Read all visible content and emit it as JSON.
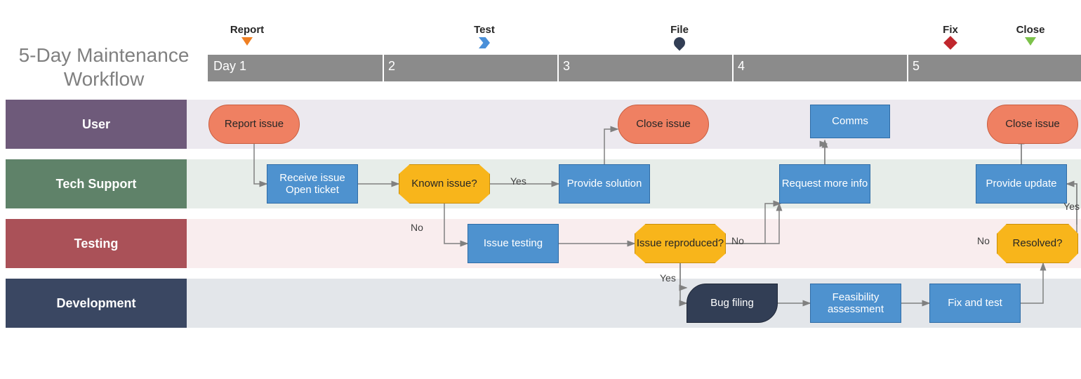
{
  "title": "5-Day Maintenance Workflow",
  "days": [
    "Day 1",
    "2",
    "3",
    "4",
    "5"
  ],
  "milestones": [
    {
      "label": "Report",
      "shape": "tri",
      "color": "#ef7f22"
    },
    {
      "label": "Test",
      "shape": "chevron",
      "color": "#4a90d9"
    },
    {
      "label": "File",
      "shape": "drop",
      "color": "#323e55"
    },
    {
      "label": "Fix",
      "shape": "diamond",
      "color": "#c0272d"
    },
    {
      "label": "Close",
      "shape": "tri",
      "color": "#7cc24a"
    }
  ],
  "lanes": [
    "User",
    "Tech Support",
    "Testing",
    "Development"
  ],
  "nodes": {
    "report_issue": "Report issue",
    "receive_open": "Receive issue\nOpen ticket",
    "known_issue": "Known issue?",
    "provide_solution": "Provide solution",
    "close_issue_a": "Close issue",
    "issue_testing": "Issue testing",
    "issue_repro": "Issue reproduced?",
    "request_more": "Request more info",
    "comms": "Comms",
    "bug_filing": "Bug filing",
    "feasibility": "Feasibility assessment",
    "fix_test": "Fix and test",
    "resolved": "Resolved?",
    "provide_update": "Provide update",
    "close_issue_b": "Close issue"
  },
  "edge_labels": {
    "yes": "Yes",
    "no": "No"
  },
  "chart_data": {
    "type": "swimlane-flowchart",
    "title": "5-Day Maintenance Workflow",
    "timeline": {
      "unit": "day",
      "start": 1,
      "end": 5,
      "milestones": [
        {
          "name": "Report",
          "day": 1
        },
        {
          "name": "Test",
          "day": 2
        },
        {
          "name": "File",
          "day": 3
        },
        {
          "name": "Fix",
          "day": 5
        },
        {
          "name": "Close",
          "day": 5
        }
      ]
    },
    "lanes": [
      "User",
      "Tech Support",
      "Testing",
      "Development"
    ],
    "nodes": [
      {
        "id": "report_issue",
        "lane": "User",
        "day": 1,
        "type": "terminator",
        "label": "Report issue"
      },
      {
        "id": "receive_open",
        "lane": "Tech Support",
        "day": 1,
        "type": "process",
        "label": "Receive issue / Open ticket"
      },
      {
        "id": "known_issue",
        "lane": "Tech Support",
        "day": 2,
        "type": "decision",
        "label": "Known issue?"
      },
      {
        "id": "provide_solution",
        "lane": "Tech Support",
        "day": 3,
        "type": "process",
        "label": "Provide solution"
      },
      {
        "id": "close_issue_a",
        "lane": "User",
        "day": 3,
        "type": "terminator",
        "label": "Close issue"
      },
      {
        "id": "issue_testing",
        "lane": "Testing",
        "day": 2,
        "type": "process",
        "label": "Issue testing"
      },
      {
        "id": "issue_repro",
        "lane": "Testing",
        "day": 3,
        "type": "decision",
        "label": "Issue reproduced?"
      },
      {
        "id": "request_more",
        "lane": "Tech Support",
        "day": 4,
        "type": "process",
        "label": "Request more info"
      },
      {
        "id": "comms",
        "lane": "User",
        "day": 4,
        "type": "process",
        "label": "Comms"
      },
      {
        "id": "bug_filing",
        "lane": "Development",
        "day": 3,
        "type": "document",
        "label": "Bug filing"
      },
      {
        "id": "feasibility",
        "lane": "Development",
        "day": 4,
        "type": "process",
        "label": "Feasibility assessment"
      },
      {
        "id": "fix_test",
        "lane": "Development",
        "day": 5,
        "type": "process",
        "label": "Fix and test"
      },
      {
        "id": "resolved",
        "lane": "Testing",
        "day": 5,
        "type": "decision",
        "label": "Resolved?"
      },
      {
        "id": "provide_update",
        "lane": "Tech Support",
        "day": 5,
        "type": "process",
        "label": "Provide update"
      },
      {
        "id": "close_issue_b",
        "lane": "User",
        "day": 5,
        "type": "terminator",
        "label": "Close issue"
      }
    ],
    "edges": [
      {
        "from": "report_issue",
        "to": "receive_open"
      },
      {
        "from": "receive_open",
        "to": "known_issue"
      },
      {
        "from": "known_issue",
        "to": "provide_solution",
        "label": "Yes"
      },
      {
        "from": "known_issue",
        "to": "issue_testing",
        "label": "No"
      },
      {
        "from": "provide_solution",
        "to": "close_issue_a"
      },
      {
        "from": "issue_testing",
        "to": "issue_repro"
      },
      {
        "from": "issue_repro",
        "to": "request_more",
        "label": "No"
      },
      {
        "from": "issue_repro",
        "to": "bug_filing",
        "label": "Yes"
      },
      {
        "from": "request_more",
        "to": "comms"
      },
      {
        "from": "bug_filing",
        "to": "feasibility"
      },
      {
        "from": "feasibility",
        "to": "fix_test"
      },
      {
        "from": "fix_test",
        "to": "resolved"
      },
      {
        "from": "resolved",
        "to": "provide_update",
        "label": "Yes"
      },
      {
        "from": "resolved",
        "to": "fix_test",
        "label": "No"
      },
      {
        "from": "provide_update",
        "to": "close_issue_b"
      }
    ]
  }
}
